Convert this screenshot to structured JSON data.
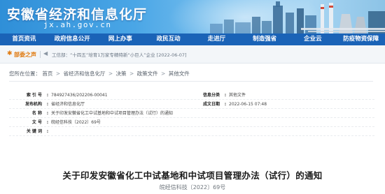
{
  "header": {
    "site_title": "安徽省经济和信息化厅",
    "domain": "jx.ah.gov.cn"
  },
  "nav": {
    "items": [
      "首页资讯",
      "政府信息公开",
      "网上办事",
      "政民互动",
      "走进厅",
      "制造强省",
      "企业云",
      "防疫物资保障"
    ]
  },
  "notice": {
    "label": "部委之声",
    "text": "工信部：“十四五”培育1万家专精特新“小巨人”企业 [2022-06-07]"
  },
  "breadcrumb": {
    "prefix": "您所在位置：",
    "items": [
      "首页",
      "省经济和信息化厅",
      "决策",
      "政策文件",
      "其他文件"
    ],
    "separator": ">"
  },
  "doc_info": {
    "index_label": "索 引 号",
    "index_value": "784927436/202206-00041",
    "category_label": "信息分类",
    "category_value": "其他文件",
    "issuer_label": "发布机构",
    "issuer_value": "省经济和信息化厅",
    "date_label": "成文日期",
    "date_value": "2022-06-15 07:48",
    "name_label": "名 称",
    "name_value": "关于印发安徽省化工中试基地和中试项目管理办法（试行）的通知",
    "docno_label": "文 号",
    "docno_value": "皖经信科技〔2022〕69号",
    "keywords_label": "关 键 词",
    "keywords_value": ""
  },
  "article": {
    "title": "关于印发安徽省化工中试基地和中试项目管理办法（试行）的通知",
    "doc_number": "皖经信科技〔2022〕69号"
  },
  "colors": {
    "nav_bg": "#1a63b7",
    "header_bg": "#3b95dc",
    "accent_orange": "#e07a10"
  }
}
